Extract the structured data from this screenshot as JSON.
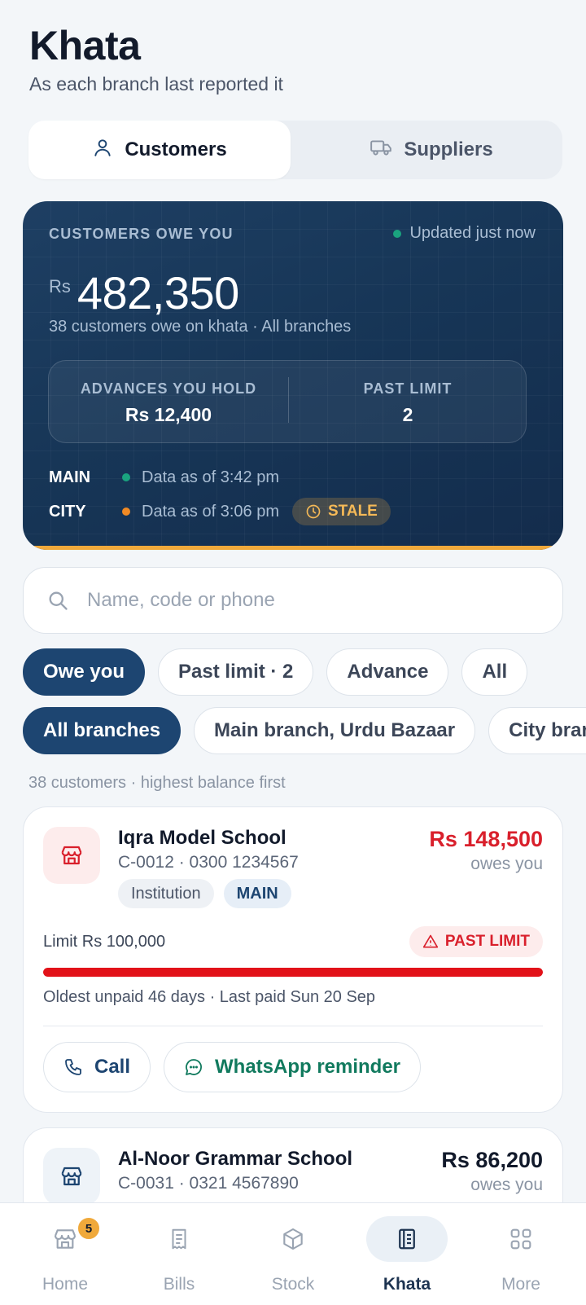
{
  "header": {
    "title": "Khata",
    "subtitle": "As each branch last reported it"
  },
  "tabs": [
    {
      "label": "Customers",
      "icon": "person-icon",
      "active": true
    },
    {
      "label": "Suppliers",
      "icon": "truck-icon",
      "active": false
    }
  ],
  "summary": {
    "label": "CUSTOMERS OWE YOU",
    "updated": "Updated just now",
    "currency": "Rs",
    "amount": "482,350",
    "subtitle": "38 customers owe on khata · All branches",
    "advances_label": "ADVANCES YOU HOLD",
    "advances_value": "Rs 12,400",
    "past_limit_label": "PAST LIMIT",
    "past_limit_value": "2",
    "branches": [
      {
        "name": "MAIN",
        "status": "Data as of 3:42 pm",
        "dot_color": "#1aa37f",
        "stale": false
      },
      {
        "name": "CITY",
        "status": "Data as of 3:06 pm",
        "dot_color": "#f08a24",
        "stale": true,
        "stale_label": "STALE"
      }
    ],
    "colors": {
      "card_bg": "#173657",
      "accent": "#f0a93b"
    }
  },
  "search": {
    "placeholder": "Name, code or phone",
    "value": ""
  },
  "filters": [
    "Owe you",
    "Past limit · 2",
    "Advance",
    "All"
  ],
  "branch_filters": [
    "All branches",
    "Main branch, Urdu Bazaar",
    "City branch"
  ],
  "list_meta": "38 customers · highest balance first",
  "customers": [
    {
      "name": "Iqra Model School",
      "meta": "C-0012 · 0300 1234567",
      "tags": [
        "Institution",
        "MAIN"
      ],
      "balance": "Rs 148,500",
      "balance_note": "owes you",
      "limit": "Limit Rs 100,000",
      "flag": "PAST LIMIT",
      "limit_used_fraction": 1.0,
      "oldest": "Oldest unpaid 46 days · Last paid Sun 20 Sep",
      "actions": [
        "Call",
        "WhatsApp reminder"
      ]
    },
    {
      "name": "Al-Noor Grammar School",
      "meta": "C-0031 · 0321 4567890",
      "balance": "Rs 86,200",
      "balance_note": "owes you"
    }
  ],
  "nav": [
    {
      "label": "Home",
      "icon": "store-icon",
      "badge": "5"
    },
    {
      "label": "Bills",
      "icon": "receipt-icon"
    },
    {
      "label": "Stock",
      "icon": "box-icon"
    },
    {
      "label": "Khata",
      "icon": "ledger-icon",
      "active": true
    },
    {
      "label": "More",
      "icon": "grid-icon"
    }
  ]
}
